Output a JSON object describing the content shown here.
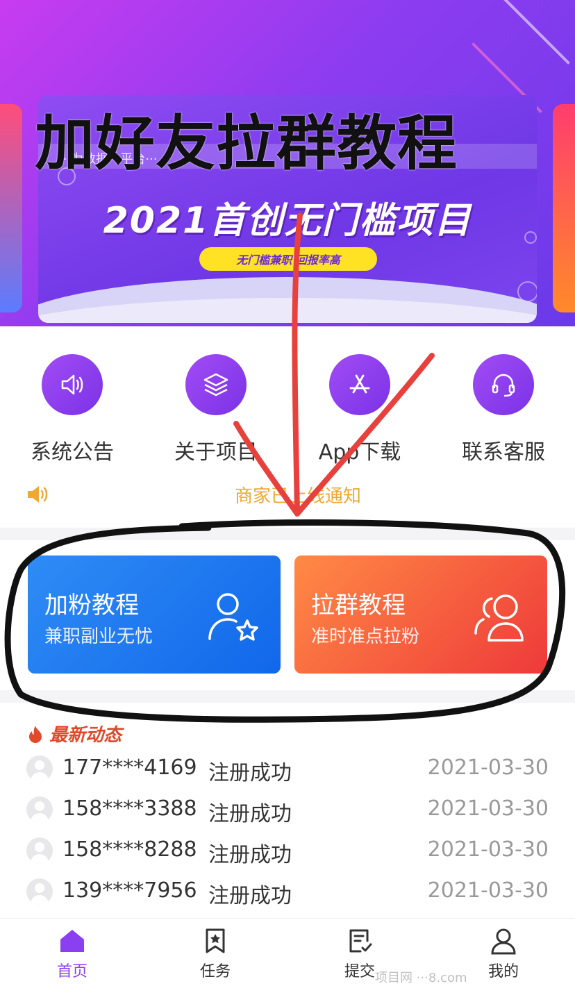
{
  "overlay_title": "加好友拉群教程",
  "banner": {
    "ribbon_text": "···为数据···平台···",
    "headline": "2021首创无门槛项目",
    "pill": "无门槛兼职 回报率高"
  },
  "menu": [
    {
      "label": "系统公告",
      "icon": "speaker-icon"
    },
    {
      "label": "关于项目",
      "icon": "layers-icon"
    },
    {
      "label": "App下载",
      "icon": "app-store-icon"
    },
    {
      "label": "联系客服",
      "icon": "headset-icon"
    }
  ],
  "notice": {
    "text": "商家已上线通知",
    "icon": "speaker-small-icon"
  },
  "cards": [
    {
      "title": "加粉教程",
      "subtitle": "兼职副业无忧",
      "icon": "user-star-icon"
    },
    {
      "title": "拉群教程",
      "subtitle": "准时准点拉粉",
      "icon": "group-icon"
    }
  ],
  "feed": {
    "title": "最新动态",
    "rows": [
      {
        "phone": "177****4169",
        "status": "注册成功",
        "date": "2021-03-30"
      },
      {
        "phone": "158****3388",
        "status": "注册成功",
        "date": "2021-03-30"
      },
      {
        "phone": "158****8288",
        "status": "注册成功",
        "date": "2021-03-30"
      },
      {
        "phone": "139****7956",
        "status": "注册成功",
        "date": "2021-03-30"
      }
    ]
  },
  "tabs": [
    {
      "label": "首页",
      "icon": "home-icon",
      "active": true
    },
    {
      "label": "任务",
      "icon": "bookmark-icon",
      "active": false
    },
    {
      "label": "提交",
      "icon": "submit-icon",
      "active": false
    },
    {
      "label": "我的",
      "icon": "user-icon",
      "active": false
    }
  ],
  "watermark": "项目网 ···8.com",
  "colors": {
    "accent": "#8a3ff0",
    "card_blue": "#1f7bf0",
    "card_orange": "#f2583e",
    "notice": "#f0a830",
    "marker_red": "#e8403c",
    "marker_black": "#111111"
  }
}
